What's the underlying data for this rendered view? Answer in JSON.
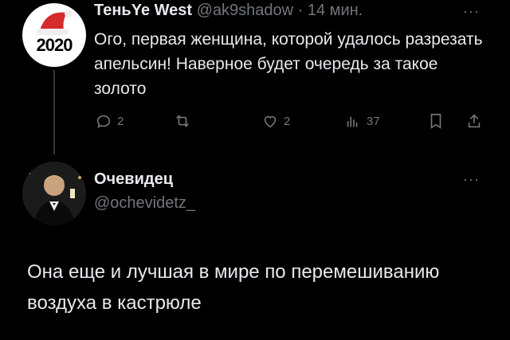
{
  "reply_tweet": {
    "display_name": "ТеньYe West",
    "handle": "@ak9shadow",
    "separator": "·",
    "time": "14 мин.",
    "avatar_text": "2020",
    "text": "Ого, первая женщина, которой удалось разрезать апельсин! Наверное будет очередь за такое золото",
    "actions": {
      "replies": "2",
      "likes": "2",
      "views": "37"
    }
  },
  "main_tweet": {
    "display_name": "Очевидец",
    "handle": "@ochevidetz_",
    "text": "Она еще и лучшая в мире по перемешиванию воздуха в кастрюле"
  },
  "icons": {
    "more": "more-icon",
    "reply": "reply-icon",
    "retweet": "retweet-icon",
    "like": "like-icon",
    "views": "views-icon",
    "bookmark": "bookmark-icon",
    "share": "share-icon"
  }
}
